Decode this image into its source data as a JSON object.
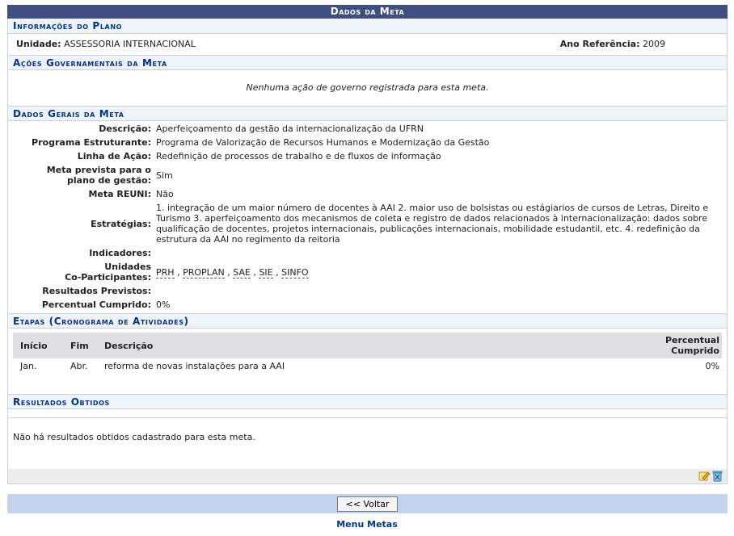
{
  "caption": "Dados da Meta",
  "informacoes": {
    "title": "Informações do Plano",
    "unidade_label": "Unidade:",
    "unidade_value": "ASSESSORIA INTERNACIONAL",
    "ano_label": "Ano Referência:",
    "ano_value": "2009"
  },
  "acoes": {
    "title": "Ações Governamentais da Meta",
    "empty_msg": "Nenhuma ação de governo registrada para esta meta."
  },
  "dados_gerais": {
    "title": "Dados Gerais da Meta",
    "descricao_label": "Descrição:",
    "descricao_value": "Aperfeiçoamento da gestão da internacionalização da UFRN",
    "programa_label": "Programa Estruturante:",
    "programa_value": "Programa de Valorização de Recursos Humanos e Modernização da Gestão",
    "linha_label": "Linha de Ação:",
    "linha_value": "Redefinição de processos de trabalho e de fluxos de informação",
    "meta_prevista_label_1": "Meta prevista para o",
    "meta_prevista_label_2": "plano de gestão:",
    "meta_prevista_value": "Sim",
    "reuni_label": "Meta REUNI:",
    "reuni_value": "Não",
    "estrategias_label": "Estratégias:",
    "estrategias_value": "1. integração de um maior número de docentes à AAI 2. maior uso de bolsistas ou estágiarios de cursos de Letras, Direito e Turismo 3. aperfeiçoamento dos mecanismos de coleta e registro de dados relacionados à internacionalização: dados sobre qualificação de docentes, projetos internacionais, publicações internacionais, mobilidade estudantil, etc. 4. redefinição da estrutura da AAI no regimento da reitoria",
    "indicadores_label": "Indicadores:",
    "unidades_label_1": "Unidades",
    "unidades_label_2": "Co-Participantes:",
    "unidades": [
      "PRH",
      "PROPLAN",
      "SAE",
      "SIE",
      "SINFO"
    ],
    "separator": " , ",
    "resultados_label": "Resultados Previstos:",
    "percentual_label": "Percentual Cumprido:",
    "percentual_value": "0%"
  },
  "etapas": {
    "title": "Etapas (Cronograma de Atividades)",
    "col_inicio": "Início",
    "col_fim": "Fim",
    "col_descricao": "Descrição",
    "col_percentual_1": "Percentual",
    "col_percentual_2": "Cumprido",
    "rows": [
      {
        "inicio": "Jan.",
        "fim": "Abr.",
        "descricao": "reforma de novas instalações para a AAI",
        "percentual": "0%"
      }
    ]
  },
  "resultados": {
    "title": "Resultados Obtidos",
    "empty_msg": "Não há resultados obtidos cadastrado para esta meta."
  },
  "buttons": {
    "voltar": "<< Voltar"
  },
  "menu_link": "Menu Metas",
  "icons": [
    "edit-icon",
    "delete-icon"
  ]
}
